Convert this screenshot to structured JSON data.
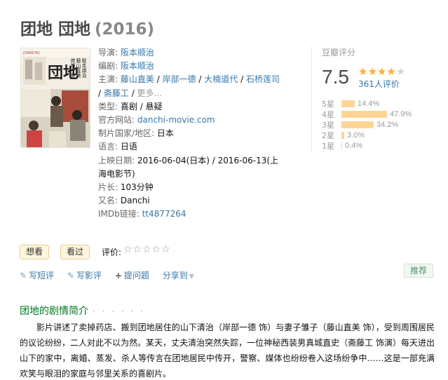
{
  "title": {
    "name": "团地 団地",
    "year": "(2016)"
  },
  "poster": {
    "label_top": "[DANCHI]",
    "title_big": "団地",
    "cast_vertical_1": "阪本順治",
    "cast_vertical_2": "藤山直美",
    "cast_vertical_3": "岸部一徳"
  },
  "info": {
    "director": {
      "label": "导演:",
      "value": "阪本顺治"
    },
    "writer": {
      "label": "编剧:",
      "value": "阪本顺治"
    },
    "cast": {
      "label": "主演:",
      "names": [
        "藤山直美",
        "岸部一德",
        "大楠道代",
        "石桥莲司",
        "斋藤工"
      ],
      "sep": " / ",
      "more": "更多..."
    },
    "genre": {
      "label": "类型:",
      "value": "喜剧 / 悬疑"
    },
    "website": {
      "label": "官方网站:",
      "value": "danchi-movie.com"
    },
    "country": {
      "label": "制片国家/地区:",
      "value": "日本"
    },
    "language": {
      "label": "语言:",
      "value": "日语"
    },
    "release": {
      "label": "上映日期:",
      "value": "2016-06-04(日本) / 2016-06-13(上海电影节)"
    },
    "runtime": {
      "label": "片长:",
      "value": "103分钟"
    },
    "aka": {
      "label": "又名:",
      "value": "Danchi"
    },
    "imdb": {
      "label": "IMDb链接:",
      "value": "tt4877264"
    }
  },
  "rating": {
    "title": "豆瓣评分",
    "score": "7.5",
    "stars_on": "★★★★",
    "stars_off": "★",
    "votes": "361人评价",
    "bars": [
      {
        "label": "5星",
        "pct_text": "14.4%",
        "fraction": 0.144
      },
      {
        "label": "4星",
        "pct_text": "47.9%",
        "fraction": 0.479
      },
      {
        "label": "3星",
        "pct_text": "34.2%",
        "fraction": 0.342
      },
      {
        "label": "2星",
        "pct_text": "3.0%",
        "fraction": 0.03
      },
      {
        "label": "1星",
        "pct_text": "0.4%",
        "fraction": 0.004
      }
    ]
  },
  "buttons": {
    "want": "想看",
    "seen": "看过",
    "rate_label": "评价:",
    "rate_stars": "☆☆☆☆☆"
  },
  "actions": {
    "short_review": "写短评",
    "review": "写影评",
    "question": "提问题",
    "share": "分享到",
    "recommend": "推荐"
  },
  "summary": {
    "title": "团地的剧情简介",
    "dots": "· · · · · ·",
    "text": "影片讲述了卖掉药店、搬到团地居住的山下清治（岸部一德 饰）与妻子雏子（藤山直美 饰），受到周围居民的议论纷纷，二人对此不以为然。某天，丈夫清治突然失踪，一位神秘西装男真城直史（斋藤工 饰演）每天进出山下的家中，离婚、蒸发、杀人等传言在团地居民中传开，警察、媒体也纷纷卷入这场纷争中……这是一部充满欢笑与眼泪的家庭与邻里关系的喜剧片。"
  }
}
